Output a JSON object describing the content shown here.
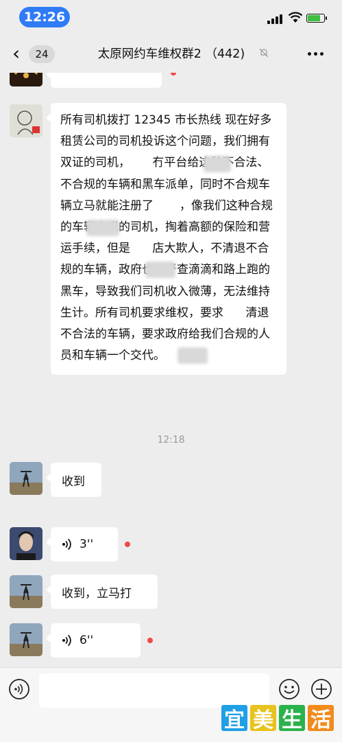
{
  "status": {
    "time": "12:26"
  },
  "nav": {
    "back_count": "24",
    "title": "太原网约车维权群2 （442)"
  },
  "chat": {
    "long_message": "所有司机拨打 12345 市长热线 现在好多租赁公司的司机投诉这个问题，我们拥有双证的司机，      冇平台给这种不合法、不合规的车辆和黑车派单，同时不合规车辆立马就能注册了       ，像我们这种合规的车辆合规的司机，掏着高额的保险和营运手续，但是      店大欺人，不清退不合规的车辆，政府也不严查滴滴和路上跑的黑车，导致我们司机收入微薄，无法维持生计。所有司机要求维权，要求      清退不合法的车辆，要求政府给我们合规的人员和车辆一个交代。",
    "timestamp": "12:18",
    "msg_received": "收到",
    "voice1_duration": "3''",
    "msg_received2": "收到，立马打",
    "voice2_duration": "6''"
  },
  "brand": {
    "chars": [
      "宜",
      "美",
      "生",
      "活"
    ],
    "colors": [
      "#1fa0e6",
      "#e8c21e",
      "#2bb24c",
      "#f28b1c"
    ]
  }
}
